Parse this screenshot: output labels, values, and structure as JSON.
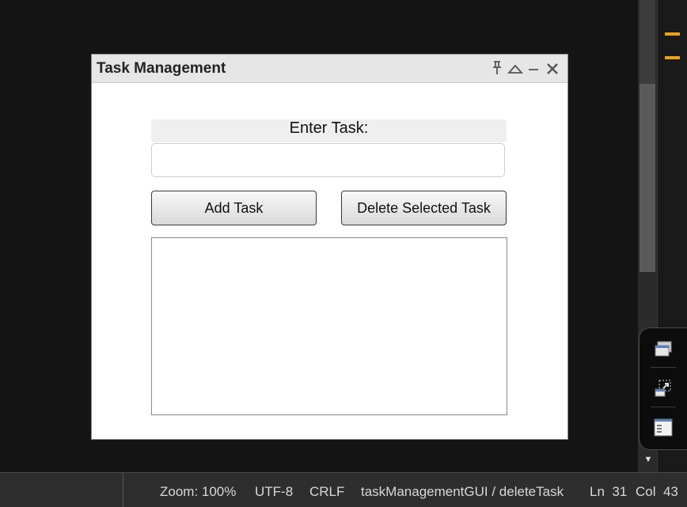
{
  "window": {
    "title": "Task Management",
    "controls": [
      "pin-icon",
      "maximize-icon",
      "minimize-icon",
      "close-icon"
    ]
  },
  "form": {
    "label": "Enter Task:",
    "task_input_value": "",
    "add_button": "Add Task",
    "delete_button": "Delete Selected Task",
    "task_list": []
  },
  "status_bar": {
    "zoom": "Zoom: 100%",
    "encoding": "UTF-8",
    "line_ending": "CRLF",
    "context": "taskManagementGUI / deleteTask",
    "line": "Ln  31",
    "col": "Col  43"
  },
  "colors": {
    "editor_background": "#141414",
    "overview_marker": "#e8a317"
  }
}
